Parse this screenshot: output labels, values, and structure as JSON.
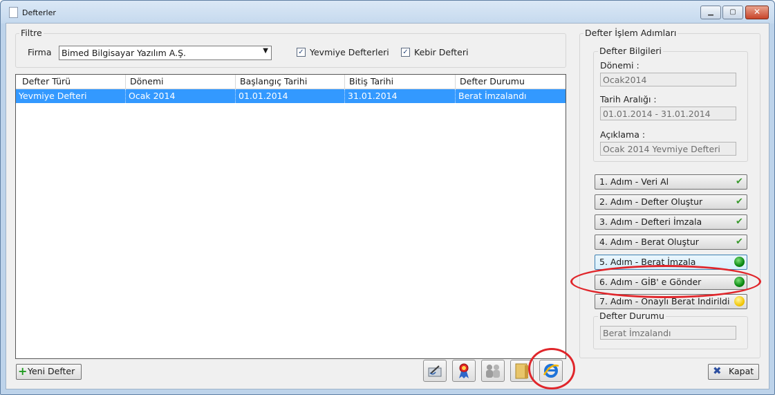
{
  "window": {
    "title": "Defterler"
  },
  "filter": {
    "group_label": "Filtre",
    "firma_label": "Firma",
    "firma_value": "Bimed Bilgisayar Yazılım A.Ş.",
    "yevmiye_label": "Yevmiye Defterleri",
    "yevmiye_checked": true,
    "kebir_label": "Kebir Defteri",
    "kebir_checked": true
  },
  "table": {
    "columns": [
      "Defter Türü",
      "Dönemi",
      "Başlangıç Tarihi",
      "Bitiş Tarihi",
      "Defter Durumu"
    ],
    "rows": [
      [
        "Yevmiye Defteri",
        "Ocak 2014",
        "01.01.2014",
        "31.01.2014",
        "Berat İmzalandı"
      ]
    ]
  },
  "bottom": {
    "new_button": "Yeni Defter",
    "icon_buttons": [
      "sign-pen-icon",
      "ribbon-award-icon",
      "users-icon",
      "folder-icon",
      "internet-explorer-icon"
    ],
    "close_button": "Kapat"
  },
  "steps_panel": {
    "title": "Defter İşlem Adımları",
    "info_group": "Defter Bilgileri",
    "donemi_label": "Dönemi :",
    "donemi_value": "Ocak2014",
    "tarih_label": "Tarih Aralığı :",
    "tarih_value": "01.01.2014 - 31.01.2014",
    "aciklama_label": "Açıklama :",
    "aciklama_value": "Ocak 2014 Yevmiye Defteri",
    "steps": [
      {
        "label": "1. Adım - Veri Al",
        "status": "done"
      },
      {
        "label": "2. Adım - Defter Oluştur",
        "status": "done"
      },
      {
        "label": "3. Adım - Defteri İmzala",
        "status": "done"
      },
      {
        "label": "4. Adım - Berat Oluştur",
        "status": "done"
      },
      {
        "label": "5. Adım - Berat İmzala",
        "status": "green"
      },
      {
        "label": "6. Adım - GİB' e Gönder",
        "status": "green"
      },
      {
        "label": "7. Adım - Onaylı Berat İndirildi",
        "status": "yellow"
      }
    ],
    "status_group": "Defter Durumu",
    "status_value": "Berat İmzalandı"
  },
  "colors": {
    "selection": "#3399ff",
    "annotation": "#e0262b"
  }
}
